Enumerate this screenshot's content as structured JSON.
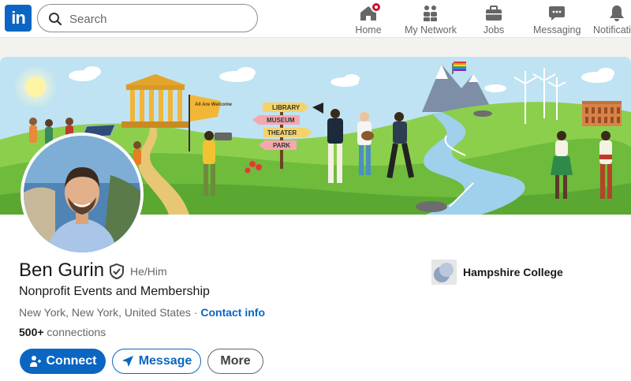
{
  "nav": {
    "logo": "in",
    "search_placeholder": "Search",
    "items": [
      {
        "label": "Home",
        "icon": "home-icon"
      },
      {
        "label": "My Network",
        "icon": "network-icon"
      },
      {
        "label": "Jobs",
        "icon": "briefcase-icon"
      },
      {
        "label": "Messaging",
        "icon": "messaging-icon"
      },
      {
        "label": "Notificati",
        "icon": "bell-icon"
      }
    ]
  },
  "banner": {
    "signs": [
      "LIBRARY",
      "MUSEUM",
      "THEATER",
      "PARK"
    ],
    "flag_text": "All Are Welcome"
  },
  "profile": {
    "name": "Ben Gurin",
    "pronouns": "He/Him",
    "headline": "Nonprofit Events and Membership",
    "location": "New York, New York, United States",
    "separator": " · ",
    "contact_info": "Contact info",
    "connections_count": "500+",
    "connections_label": " connections",
    "school": "Hampshire College"
  },
  "actions": {
    "connect": "Connect",
    "message": "Message",
    "more": "More"
  },
  "colors": {
    "brand": "#0a66c2",
    "notification_badge": "#cb112d"
  }
}
